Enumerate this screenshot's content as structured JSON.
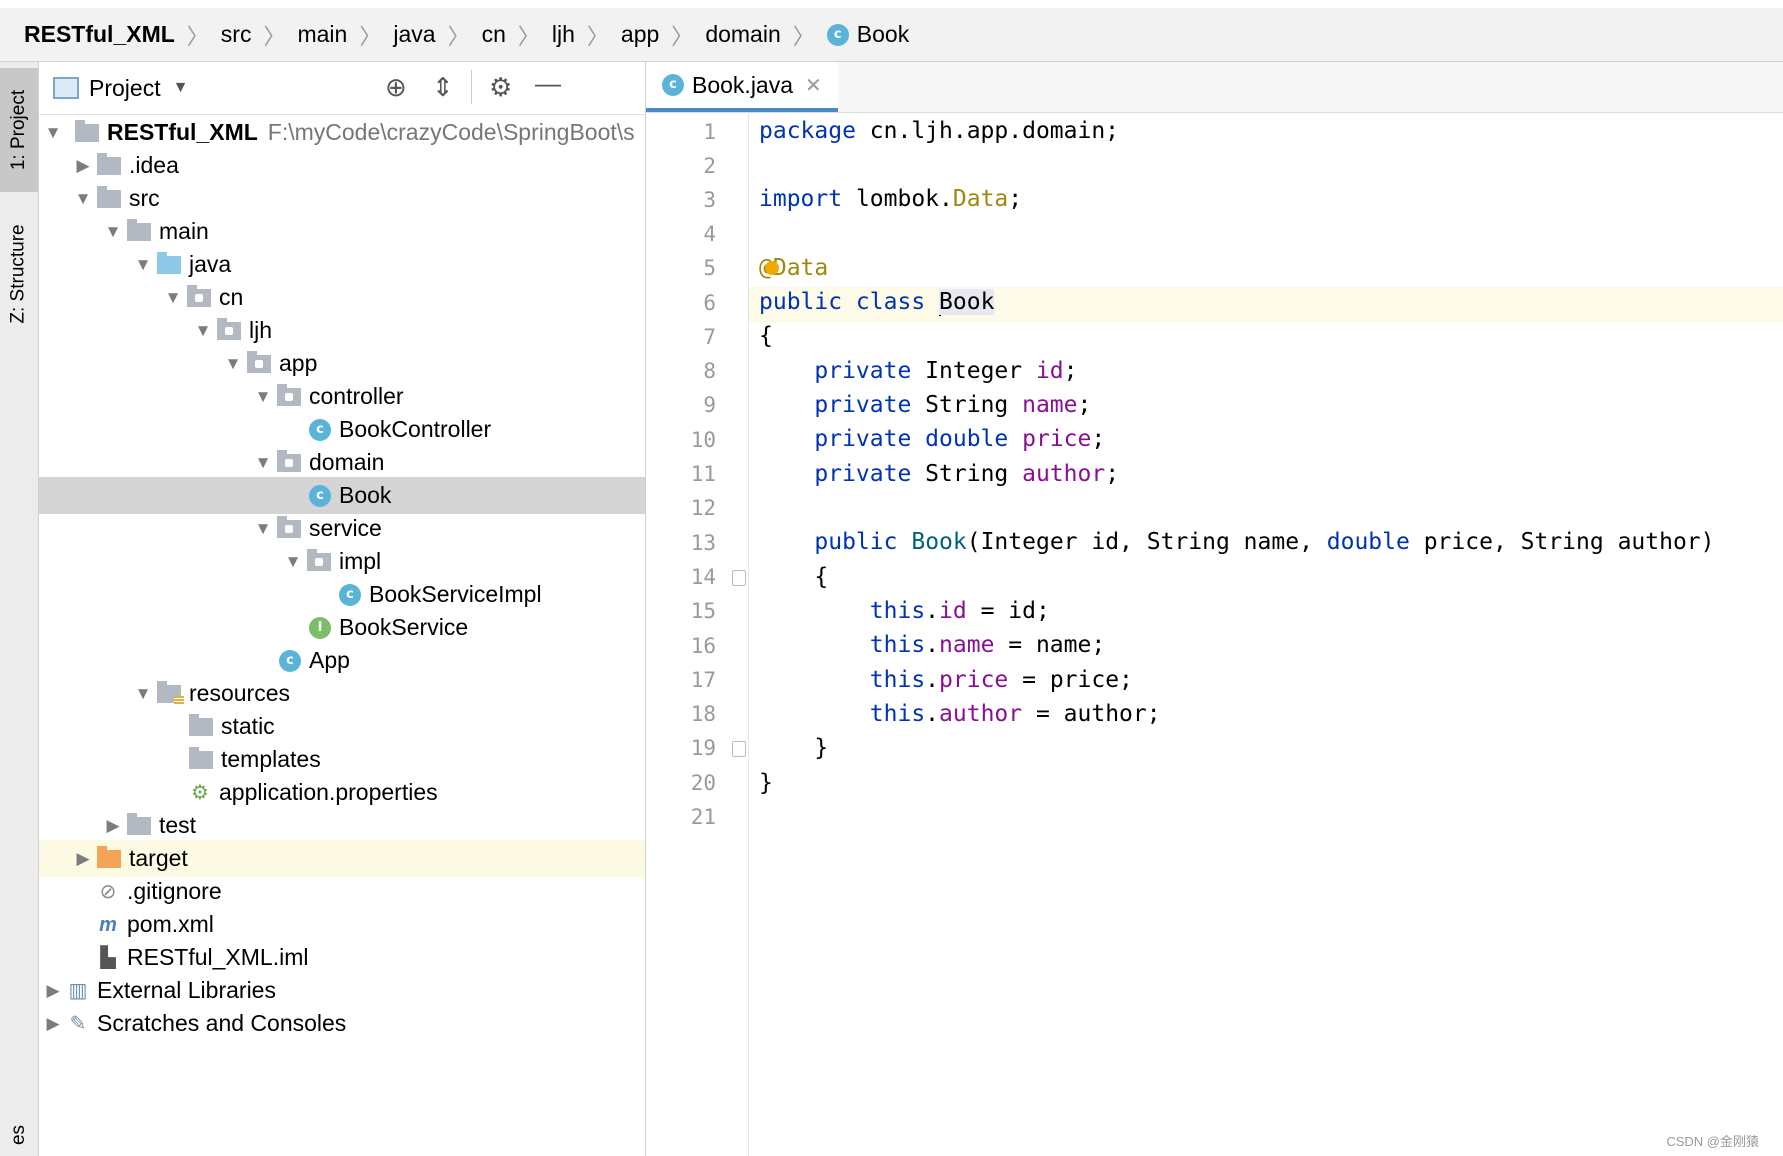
{
  "breadcrumb": {
    "items": [
      "RESTful_XML",
      "src",
      "main",
      "java",
      "cn",
      "ljh",
      "app",
      "domain",
      "Book"
    ]
  },
  "toolwindows": {
    "project_tab": "1: Project",
    "structure_tab": "Z: Structure",
    "bottom_tab": "es"
  },
  "project_panel": {
    "title": "Project",
    "tree": [
      {
        "label": "RESTful_XML",
        "path": "F:\\myCode\\crazyCode\\SpringBoot\\s"
      },
      {
        "label": ".idea"
      },
      {
        "label": "src"
      },
      {
        "label": "main"
      },
      {
        "label": "java"
      },
      {
        "label": "cn"
      },
      {
        "label": "ljh"
      },
      {
        "label": "app"
      },
      {
        "label": "controller"
      },
      {
        "label": "BookController"
      },
      {
        "label": "domain"
      },
      {
        "label": "Book"
      },
      {
        "label": "service"
      },
      {
        "label": "impl"
      },
      {
        "label": "BookServiceImpl"
      },
      {
        "label": "BookService"
      },
      {
        "label": "App"
      },
      {
        "label": "resources"
      },
      {
        "label": "static"
      },
      {
        "label": "templates"
      },
      {
        "label": "application.properties"
      },
      {
        "label": "test"
      },
      {
        "label": "target"
      },
      {
        "label": ".gitignore"
      },
      {
        "label": "pom.xml"
      },
      {
        "label": "RESTful_XML.iml"
      },
      {
        "label": "External Libraries"
      },
      {
        "label": "Scratches and Consoles"
      }
    ]
  },
  "editor": {
    "tab_label": "Book.java",
    "line_numbers": [
      "1",
      "2",
      "3",
      "4",
      "5",
      "6",
      "7",
      "8",
      "9",
      "10",
      "11",
      "12",
      "13",
      "14",
      "15",
      "16",
      "17",
      "18",
      "19",
      "20",
      "21"
    ]
  },
  "watermark": "CSDN @金刚猿"
}
